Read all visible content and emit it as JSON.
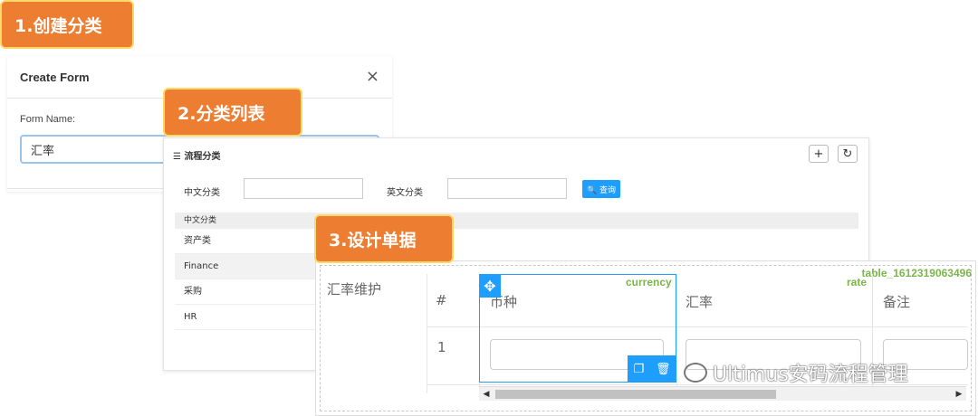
{
  "steps": {
    "step1": "1.创建分类",
    "step2": "2.分类列表",
    "step3": "3.设计单据"
  },
  "create_form": {
    "title": "Create Form",
    "close": "×",
    "name_label": "Form Name:",
    "name_value": "汇率"
  },
  "category_panel": {
    "title": "☰ 流程分类",
    "add_btn": "+",
    "refresh_btn": "↻",
    "cn_label": "中文分类",
    "en_label": "英文分类",
    "search_btn": "🔍 查询",
    "column_header": "中文分类",
    "rows": [
      "资产类",
      "Finance",
      "采购",
      "HR"
    ]
  },
  "designer": {
    "form_label": "汇率维护",
    "table_tag": "table_1612319063496",
    "hash": "#",
    "row_num": "1",
    "headers": [
      "币种",
      "汇率",
      "备注"
    ],
    "field_tags": [
      "currency",
      "rate"
    ],
    "move_icon": "✥",
    "copy_icon": "❐",
    "delete_icon": "🗑",
    "scroll_left": "◀",
    "scroll_right": "▶"
  },
  "watermark": "Ultimus安码流程管理"
}
